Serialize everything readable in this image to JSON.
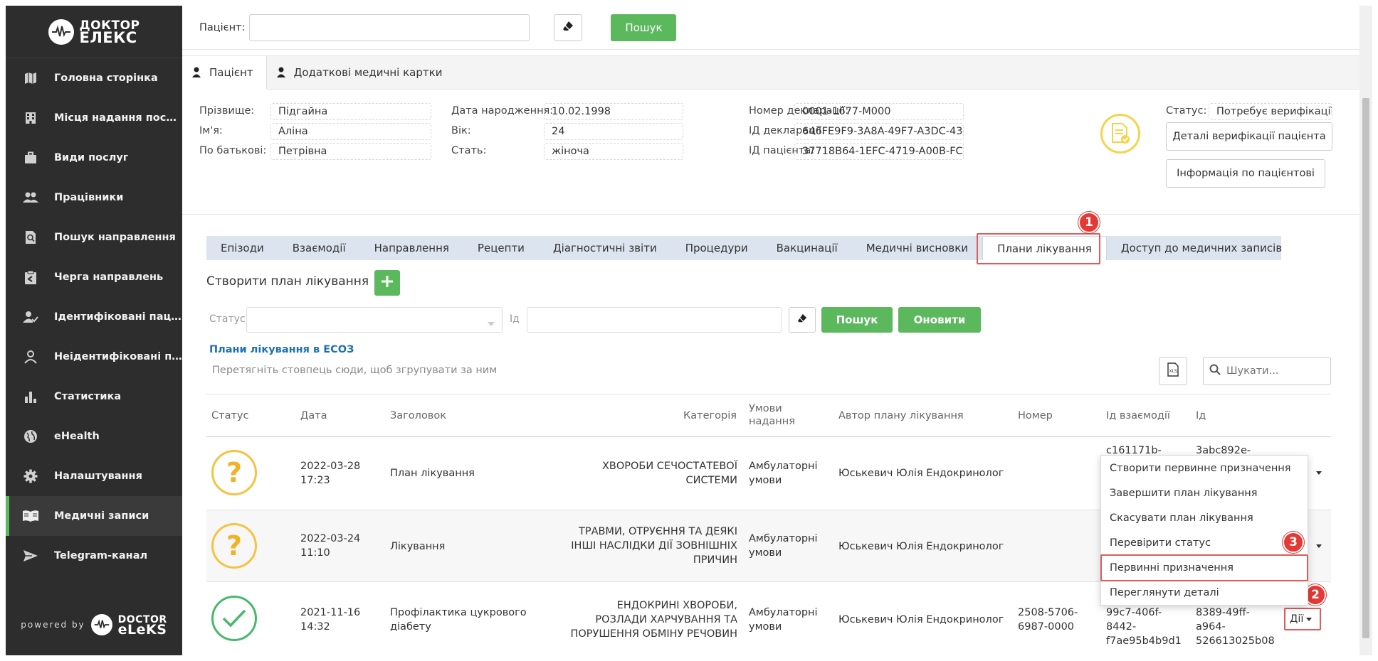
{
  "brand": {
    "line1": "ДОКТОР",
    "line2": "ЕЛЕКС",
    "powered": "powered by",
    "powered_line1": "DOCTOR",
    "powered_line2": "eLeKS"
  },
  "sidebar": {
    "items": [
      {
        "label": "Головна сторінка",
        "icon": "map-icon"
      },
      {
        "label": "Місця надання послуг",
        "icon": "building-icon"
      },
      {
        "label": "Види послуг",
        "icon": "briefcase-icon"
      },
      {
        "label": "Працівники",
        "icon": "users-icon"
      },
      {
        "label": "Пошук направлення",
        "icon": "doc-search-icon"
      },
      {
        "label": "Черга направлень",
        "icon": "clipboard-icon"
      },
      {
        "label": "Ідентифіковані пацієнти",
        "icon": "user-check-icon"
      },
      {
        "label": "Неідентифіковані паціє...",
        "icon": "user-icon"
      },
      {
        "label": "Статистика",
        "icon": "bar-chart-icon"
      },
      {
        "label": "eHealth",
        "icon": "globe-icon"
      },
      {
        "label": "Налаштування",
        "icon": "gear-icon"
      },
      {
        "label": "Медичні записи",
        "icon": "book-icon"
      },
      {
        "label": "Telegram-канал",
        "icon": "send-icon"
      }
    ]
  },
  "search": {
    "label": "Пацієнт:",
    "value": "",
    "button": "Пошук"
  },
  "patient_tabs": [
    "Пацієнт",
    "Додаткові медичні картки"
  ],
  "patient": {
    "surname_label": "Прізвище:",
    "surname": "Підгайна",
    "name_label": "Ім'я:",
    "name": "Аліна",
    "patronymic_label": "По батькові:",
    "patronymic": "Петрівна",
    "dob_label": "Дата народження:",
    "dob": "10.02.1998",
    "age_label": "Вік:",
    "age": "24",
    "sex_label": "Стать:",
    "sex": "жіноча",
    "decl_num_label": "Номер декларації:",
    "decl_num": "0001-1677-M000",
    "decl_id_label": "ІД декларації:",
    "decl_id": "646FE9F9-3A8A-49F7-A3DC-43",
    "patient_id_label": "ІД пацієнта:",
    "patient_id": "37718B64-1EFC-4719-A00B-FC",
    "status_label": "Статус:",
    "status": "Потребує верифікації",
    "verif_details_btn": "Деталі верифікації пацієнта",
    "patient_info_btn": "Інформація по пацієнтові"
  },
  "record_tabs": [
    "Епізоди",
    "Взаємодії",
    "Направлення",
    "Рецепти",
    "Діагностичні звіти",
    "Процедури",
    "Вакцинації",
    "Медичні висновки",
    "Плани лікування",
    "Доступ до медичних записів"
  ],
  "active_record_tab": "Плани лікування",
  "create_plan_label": "Створити план лікування",
  "filters": {
    "status_label": "Статус",
    "id_label": "Ід",
    "search_btn": "Пошук",
    "refresh_btn": "Оновити"
  },
  "section_title": "Плани лікування в ЕСОЗ",
  "group_hint": "Перетягніть стовпець сюди, щоб згрупувати за ним",
  "grid_search_placeholder": "Шукати...",
  "table": {
    "headers": {
      "status": "Статус",
      "date": "Дата",
      "title": "Заголовок",
      "category": "Категорія",
      "conditions_1": "Умови",
      "conditions_2": "надання",
      "author": "Автор плану лікування",
      "number": "Номер",
      "interaction_id": "Ід взаємодії",
      "id": "Ід"
    },
    "rows": [
      {
        "status": "pending",
        "date_1": "2022-03-28",
        "date_2": "17:23",
        "title_1": "План лікування",
        "title_2": "",
        "cat_1": "ХВОРОБИ СЕЧОСТАТЕВОЇ",
        "cat_2": "СИСТЕМИ",
        "cat_3": "",
        "cond_1": "Амбулаторні",
        "cond_2": "умови",
        "author": "Юськевич Юлія Ендокринолог",
        "num_1": "",
        "num_2": "",
        "iid_1": "c161171b-",
        "iid_2": "",
        "iid_3": "",
        "id_1": "3abc892e-",
        "id_2": "",
        "id_3": ""
      },
      {
        "status": "pending",
        "date_1": "2022-03-24",
        "date_2": "11:10",
        "title_1": "Лікування",
        "title_2": "",
        "cat_1": "ТРАВМИ, ОТРУЄННЯ ТА ДЕЯКІ",
        "cat_2": "ІНШІ НАСЛІДКИ ДІЇ ЗОВНІШНІХ",
        "cat_3": "ПРИЧИН",
        "cond_1": "Амбулаторні",
        "cond_2": "умови",
        "author": "Юськевич Юлія Ендокринолог",
        "num_1": "",
        "num_2": "",
        "iid_1": "",
        "iid_2": "",
        "iid_3": "",
        "id_1": "",
        "id_2": "",
        "id_3": ""
      },
      {
        "status": "completed",
        "date_1": "2021-11-16",
        "date_2": "14:32",
        "title_1": "Профілактика цукрового",
        "title_2": "діабету",
        "cat_1": "ЕНДОКРИНІ ХВОРОБИ,",
        "cat_2": "РОЗЛАДИ ХАРЧУВАННЯ ТА",
        "cat_3": "ПОРУШЕННЯ ОБМІНУ РЕЧОВИН",
        "cond_1": "Амбулаторні",
        "cond_2": "умови",
        "author": "Юськевич Юлія Ендокринолог",
        "num_1": "2508-5706-",
        "num_2": "6987-0000",
        "iid_1": "99c7-406f-",
        "iid_2": "8442-",
        "iid_3": "f7ae95b4b9d1",
        "id_1": "8389-49ff-",
        "id_2": "a964-",
        "id_3": "526613025b08",
        "actions": "Дії"
      }
    ]
  },
  "dropdown_items": [
    "Створити первинне призначення",
    "Завершити план лікування",
    "Скасувати план лікування",
    "Перевірити статус",
    "Первинні призначення",
    "Переглянути деталі"
  ],
  "annotations": [
    "1",
    "2",
    "3"
  ],
  "colors": {
    "accent_green": "#5cb85c",
    "highlight_red": "#e05a5a",
    "sidebar_bg": "#2d2d2d",
    "tab_bar_bg": "#dce5ef",
    "pending_yellow": "#f5c242",
    "completed_green": "#49b86b"
  }
}
